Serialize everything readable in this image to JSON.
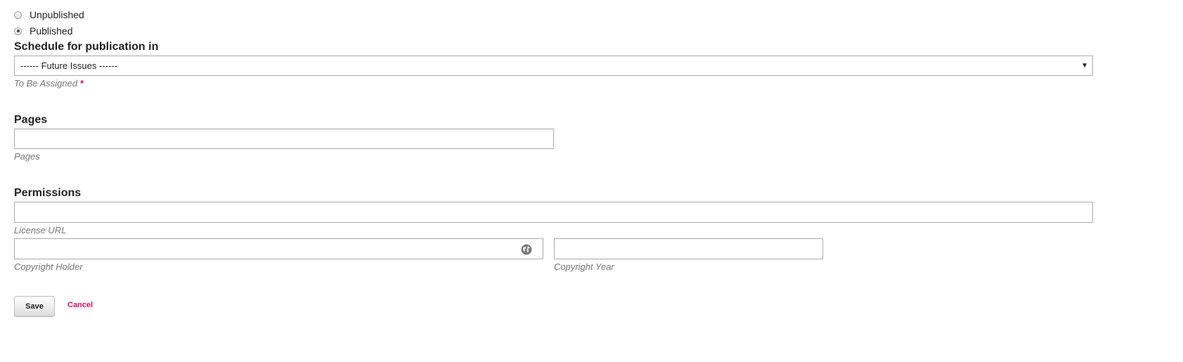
{
  "status": {
    "options": [
      {
        "label": "Unpublished",
        "checked": false
      },
      {
        "label": "Published",
        "checked": true
      }
    ]
  },
  "schedule": {
    "title": "Schedule for publication in",
    "selected": "------ Future Issues ------",
    "hint": "To Be Assigned",
    "required_mark": "*"
  },
  "pages": {
    "title": "Pages",
    "value": "",
    "hint": "Pages"
  },
  "permissions": {
    "title": "Permissions",
    "license_url": {
      "value": "",
      "hint": "License URL"
    },
    "copyright_holder": {
      "value": "",
      "hint": "Copyright Holder",
      "icon": "globe-icon"
    },
    "copyright_year": {
      "value": "",
      "hint": "Copyright Year"
    }
  },
  "actions": {
    "save_label": "Save",
    "cancel_label": "Cancel"
  },
  "colors": {
    "accent": "#d00a6c",
    "border": "#aaaaaa",
    "hint_text": "#777777"
  }
}
